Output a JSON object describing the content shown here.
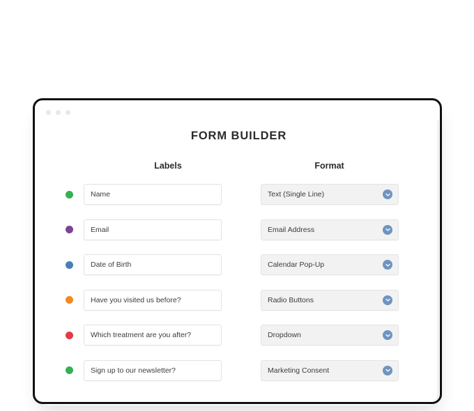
{
  "window": {
    "traffic_lights": [
      "close-dot",
      "minimize-dot",
      "maximize-dot"
    ]
  },
  "page": {
    "title": "FORM BUILDER"
  },
  "columns": {
    "labels_header": "Labels",
    "format_header": "Format"
  },
  "icons": {
    "chevron": "chevron-down-icon"
  },
  "colors": {
    "frame": "#111111",
    "dropdown_bg": "#f2f2f3",
    "chevron_badge": "#6f94c0",
    "text": "#3c3c3c",
    "heading": "#2b2b2b"
  },
  "rows": [
    {
      "dot_color": "#35b152",
      "dot_name": "status-dot-green",
      "label": "Name",
      "format": "Text (Single Line)"
    },
    {
      "dot_color": "#7b4397",
      "dot_name": "status-dot-purple",
      "label": "Email",
      "format": "Email Address"
    },
    {
      "dot_color": "#4a7fb5",
      "dot_name": "status-dot-blue",
      "label": "Date of Birth",
      "format": "Calendar Pop-Up"
    },
    {
      "dot_color": "#ef8c20",
      "dot_name": "status-dot-orange",
      "label": "Have you visited us before?",
      "format": "Radio Buttons"
    },
    {
      "dot_color": "#e63946",
      "dot_name": "status-dot-red",
      "label": "Which treatment are you after?",
      "format": "Dropdown"
    },
    {
      "dot_color": "#35b152",
      "dot_name": "status-dot-green",
      "label": "Sign up to our newsletter?",
      "format": "Marketing Consent"
    }
  ]
}
